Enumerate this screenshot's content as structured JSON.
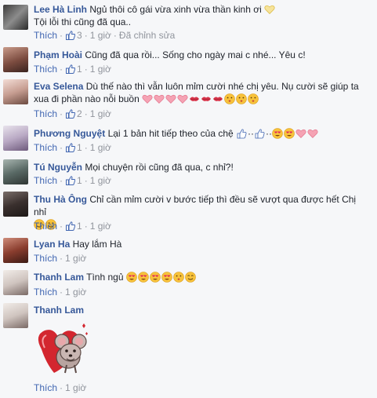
{
  "colors": {
    "name": "#365899",
    "link": "#4267b2",
    "meta": "#90949c",
    "text": "#1d2129"
  },
  "comments": [
    {
      "name": "Lee Hà Linh",
      "text": "Ngủ thôi cô gái vừa xinh vừa thần kinh ơi",
      "text2": "Tội lỗi thi cũng đã qua..",
      "like_label": "Thích",
      "like_count": "3",
      "time": "1 giờ",
      "edit": "Đã chỉnh sửa"
    },
    {
      "name": "Phạm Hoài",
      "text": "Cũng đã qua rồi... Sống cho ngày mai c nhé... Yêu c!",
      "like_label": "Thích",
      "like_count": "1",
      "time": "1 giờ"
    },
    {
      "name": "Eva Selena",
      "text": "Dù thế nào thì vẫn luôn mỉm cười nhé chị yêu. Nụ cười sẽ giúp ta xua đi phần nào nỗi buồn",
      "like_label": "Thích",
      "like_count": "2",
      "time": "1 giờ"
    },
    {
      "name": "Phương Nguyệt",
      "text": "Lại 1 bản hit tiếp theo của chệ",
      "like_label": "Thích",
      "like_count": "1",
      "time": "1 giờ"
    },
    {
      "name": "Tú Nguyễn",
      "text": "Mọi chuyện rồi cũng đã qua, c nhỉ?!",
      "like_label": "Thích",
      "like_count": "1",
      "time": "1 giờ"
    },
    {
      "name": "Thu Hà Ông",
      "text": "Chỉ cần mỉm cười v bước tiếp thì đều sẽ vượt qua được hết Chị nhỉ",
      "like_label": "Thích",
      "like_count": "1",
      "time": "1 giờ"
    },
    {
      "name": "Lyan Ha",
      "text": "Hay lắm Hà",
      "like_label": "Thích",
      "time": "1 giờ"
    },
    {
      "name": "Thanh Lam",
      "text": "Tình ngủ",
      "like_label": "Thích",
      "time": "1 giờ"
    },
    {
      "name": "Thanh Lam",
      "like_label": "Thích",
      "time": "1 giờ"
    }
  ]
}
